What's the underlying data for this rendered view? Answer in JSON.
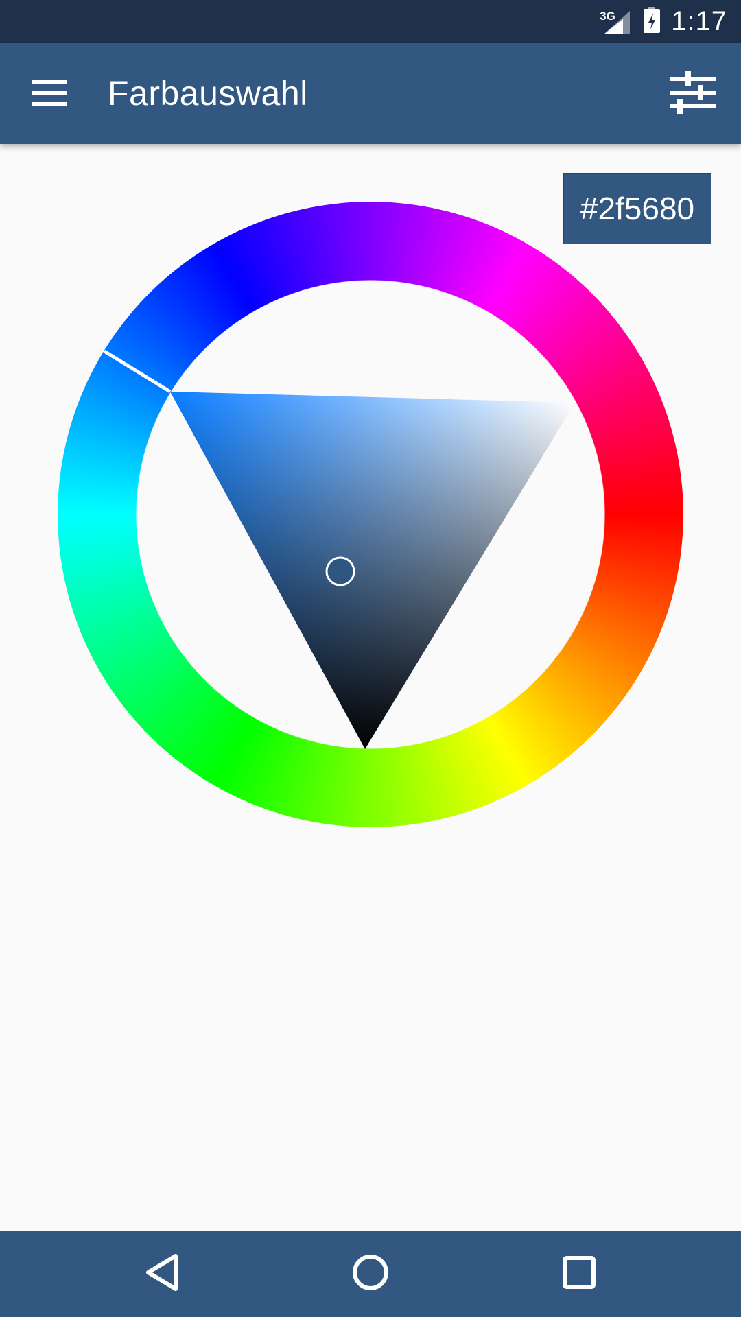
{
  "status_bar": {
    "network_label": "3G",
    "time": "1:17",
    "icons": [
      "signal-icon",
      "battery-charging-icon"
    ]
  },
  "app_bar": {
    "title": "Farbauswahl",
    "menu_icon": "hamburger-menu-icon",
    "action_icon": "tune-sliders-icon"
  },
  "color_picker": {
    "hex_value": "#2f5680",
    "selected_color": "#2f5680",
    "hue_degrees": 211,
    "saturation": 0.63,
    "value": 0.5
  },
  "navigation_bar": {
    "buttons": [
      "back-icon",
      "home-icon",
      "recents-icon"
    ]
  },
  "colors": {
    "status_bar_bg": "#1f304b",
    "app_bar_bg": "#325780",
    "page_bg": "#fafafa",
    "text_on_primary": "#ffffff"
  }
}
